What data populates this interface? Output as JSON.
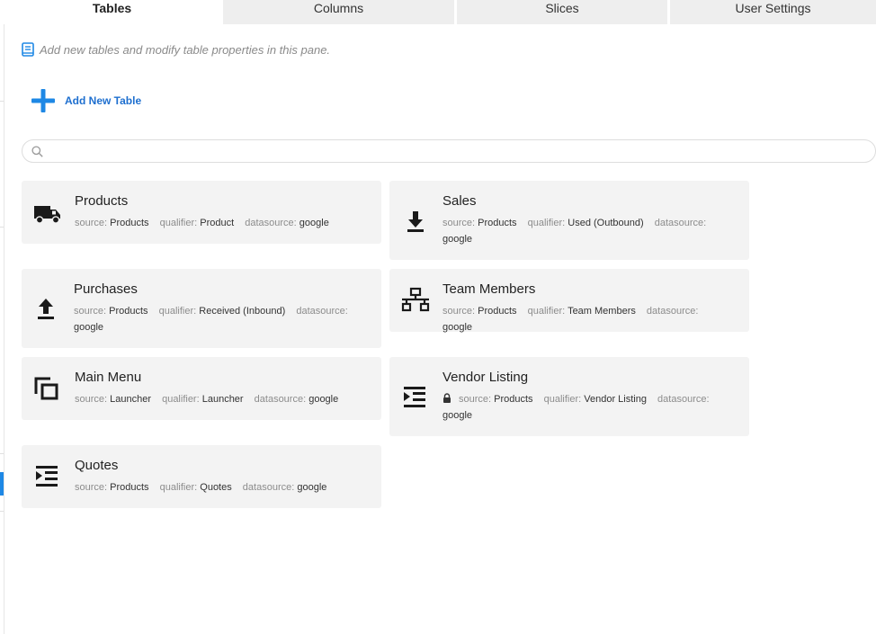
{
  "tabs": [
    {
      "label": "Tables",
      "active": true
    },
    {
      "label": "Columns",
      "active": false
    },
    {
      "label": "Slices",
      "active": false
    },
    {
      "label": "User Settings",
      "active": false
    }
  ],
  "hint": {
    "text": "Add new tables and modify table properties in this pane.",
    "icon": "book-icon"
  },
  "add_button": {
    "label": "Add New Table",
    "icon": "plus-icon",
    "color": "#1e6fcf"
  },
  "search": {
    "placeholder": "",
    "value": "",
    "icon": "search-icon"
  },
  "labels": {
    "source": "source:",
    "qualifier": "qualifier:",
    "datasource": "datasource:"
  },
  "tables": [
    {
      "name": "Products",
      "icon": "truck-icon",
      "source": "Products",
      "qualifier": "Product",
      "datasource": "google",
      "locked": false
    },
    {
      "name": "Sales",
      "icon": "download-icon",
      "source": "Products",
      "qualifier": "Used (Outbound)",
      "datasource": "google",
      "locked": false
    },
    {
      "name": "Purchases",
      "icon": "upload-icon",
      "source": "Products",
      "qualifier": "Received (Inbound)",
      "datasource": "google",
      "locked": false
    },
    {
      "name": "Team Members",
      "icon": "org-chart-icon",
      "source": "Products",
      "qualifier": "Team Members",
      "datasource": "google",
      "locked": false
    },
    {
      "name": "Main Menu",
      "icon": "copy-icon",
      "source": "Launcher",
      "qualifier": "Launcher",
      "datasource": "google",
      "locked": false
    },
    {
      "name": "Vendor Listing",
      "icon": "list-indent-icon",
      "source": "Products",
      "qualifier": "Vendor Listing",
      "datasource": "google",
      "locked": true
    },
    {
      "name": "Quotes",
      "icon": "list-indent-icon",
      "source": "Products",
      "qualifier": "Quotes",
      "datasource": "google",
      "locked": false
    }
  ],
  "colors": {
    "accent": "#1e88e5",
    "card_bg": "#f3f3f3",
    "tab_inactive_bg": "#eeeeee"
  }
}
